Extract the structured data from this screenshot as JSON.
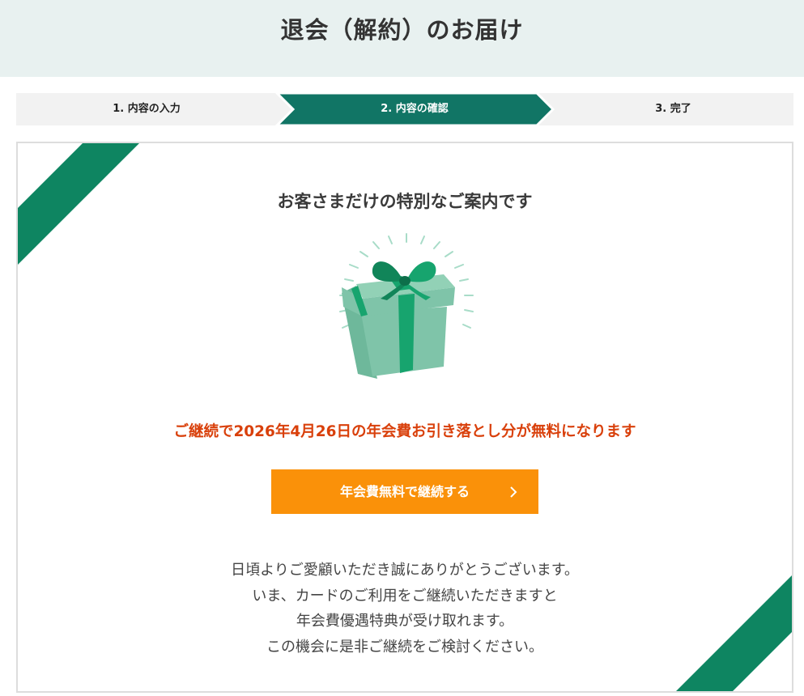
{
  "header": {
    "title": "退会（解約）のお届け"
  },
  "steps": [
    {
      "label": "1. 内容の入力",
      "active": false
    },
    {
      "label": "2. 内容の確認",
      "active": true
    },
    {
      "label": "3. 完了",
      "active": false
    }
  ],
  "offer": {
    "heading": "お客さまだけの特別なご案内です",
    "gift_icon": "gift-box-icon",
    "highlight": "ご継続で2026年4月26日の年会費お引き落とし分が無料になります",
    "button_label": "年会費無料で継続する",
    "button_icon": "chevron-right-icon",
    "message_lines": [
      "日頃よりご愛顧いただき誠にありがとうございます。",
      "いま、カードのご利用をご継続いただきますと",
      "年会費優遇特典が受け取れます。",
      "この機会に是非ご継続をご検討ください。"
    ]
  },
  "colors": {
    "header_bg": "#e8f1f0",
    "step_active": "#117565",
    "step_inactive": "#f2f2f2",
    "ribbon": "#0e8561",
    "highlight_text": "#d9400b",
    "button": "#fa9109",
    "gift_box": "#7fc4a9",
    "gift_ribbon": "#17a46e"
  }
}
